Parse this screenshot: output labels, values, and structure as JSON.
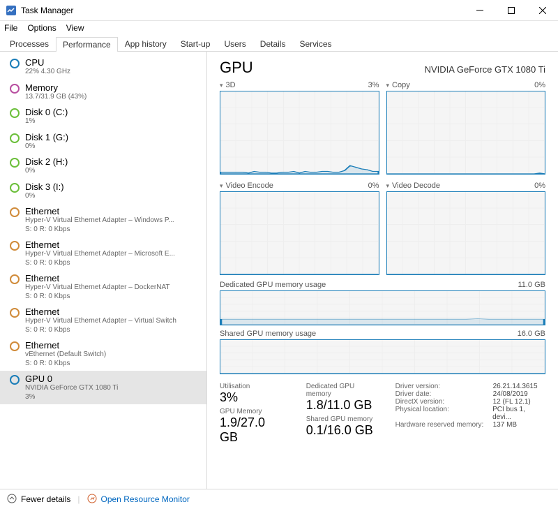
{
  "window": {
    "title": "Task Manager"
  },
  "menu": {
    "file": "File",
    "options": "Options",
    "view": "View"
  },
  "tabs": {
    "processes": "Processes",
    "performance": "Performance",
    "app_history": "App history",
    "start_up": "Start-up",
    "users": "Users",
    "details": "Details",
    "services": "Services"
  },
  "sidebar": {
    "items": [
      {
        "name": "CPU",
        "sub": "22% 4.30 GHz",
        "color": "#1a7db8"
      },
      {
        "name": "Memory",
        "sub": "13.7/31.9 GB (43%)",
        "color": "#b84fa0"
      },
      {
        "name": "Disk 0 (C:)",
        "sub": "1%",
        "color": "#6bbf3a"
      },
      {
        "name": "Disk 1 (G:)",
        "sub": "0%",
        "color": "#6bbf3a"
      },
      {
        "name": "Disk 2 (H:)",
        "sub": "0%",
        "color": "#6bbf3a"
      },
      {
        "name": "Disk 3 (I:)",
        "sub": "0%",
        "color": "#6bbf3a"
      },
      {
        "name": "Ethernet",
        "sub": "Hyper-V Virtual Ethernet Adapter – Windows P...",
        "sub2": "S: 0 R: 0 Kbps",
        "color": "#d08b3a"
      },
      {
        "name": "Ethernet",
        "sub": "Hyper-V Virtual Ethernet Adapter – Microsoft E...",
        "sub2": "S: 0 R: 0 Kbps",
        "color": "#d08b3a"
      },
      {
        "name": "Ethernet",
        "sub": "Hyper-V Virtual Ethernet Adapter – DockerNAT",
        "sub2": "S: 0 R: 0 Kbps",
        "color": "#d08b3a"
      },
      {
        "name": "Ethernet",
        "sub": "Hyper-V Virtual Ethernet Adapter – Virtual Switch",
        "sub2": "S: 0 R: 0 Kbps",
        "color": "#d08b3a"
      },
      {
        "name": "Ethernet",
        "sub": "vEthernet (Default Switch)",
        "sub2": "S: 0 R: 0 Kbps",
        "color": "#d08b3a"
      },
      {
        "name": "GPU 0",
        "sub": "NVIDIA GeForce GTX 1080 Ti",
        "sub2": "3%",
        "color": "#1a7db8"
      }
    ]
  },
  "main": {
    "title": "GPU",
    "device": "NVIDIA GeForce GTX 1080 Ti",
    "charts": [
      {
        "label": "3D",
        "value": "3%"
      },
      {
        "label": "Copy",
        "value": "0%"
      },
      {
        "label": "Video Encode",
        "value": "0%"
      },
      {
        "label": "Video Decode",
        "value": "0%"
      }
    ],
    "mem1": {
      "label": "Dedicated GPU memory usage",
      "max": "11.0 GB"
    },
    "mem2": {
      "label": "Shared GPU memory usage",
      "max": "16.0 GB"
    },
    "stats": {
      "util_label": "Utilisation",
      "util": "3%",
      "gmem_label": "GPU Memory",
      "gmem": "1.9/27.0 GB",
      "dmem_label": "Dedicated GPU memory",
      "dmem": "1.8/11.0 GB",
      "smem_label": "Shared GPU memory",
      "smem": "0.1/16.0 GB"
    },
    "details": {
      "driver_version_k": "Driver version:",
      "driver_version_v": "26.21.14.3615",
      "driver_date_k": "Driver date:",
      "driver_date_v": "24/08/2019",
      "directx_k": "DirectX version:",
      "directx_v": "12 (FL 12.1)",
      "location_k": "Physical location:",
      "location_v": "PCI bus 1, devi...",
      "reserved_k": "Hardware reserved memory:",
      "reserved_v": "137 MB"
    }
  },
  "footer": {
    "fewer": "Fewer details",
    "resmon": "Open Resource Monitor"
  },
  "chart_data": [
    {
      "type": "line",
      "title": "3D",
      "ylim": [
        0,
        100
      ],
      "values": [
        2,
        2,
        2,
        2,
        2,
        1,
        3,
        2,
        2,
        1,
        1,
        2,
        2,
        3,
        1,
        3,
        2,
        2,
        3,
        3,
        2,
        2,
        4,
        10,
        8,
        6,
        5,
        3,
        3
      ]
    },
    {
      "type": "line",
      "title": "Copy",
      "ylim": [
        0,
        100
      ],
      "values": [
        0,
        0,
        0,
        0,
        0,
        0,
        0,
        0,
        0,
        0,
        0,
        0,
        0,
        0,
        0,
        0,
        0,
        0,
        0,
        0,
        0,
        0,
        0,
        0,
        0,
        0,
        0,
        0,
        1,
        0
      ]
    },
    {
      "type": "line",
      "title": "Video Encode",
      "ylim": [
        0,
        100
      ],
      "values": [
        0,
        0,
        0,
        0,
        0,
        0,
        0,
        0,
        0,
        0,
        0,
        0,
        0,
        0,
        0,
        0,
        0,
        0,
        0,
        0,
        0,
        0,
        0,
        0,
        0,
        0,
        0,
        0,
        0,
        0
      ]
    },
    {
      "type": "line",
      "title": "Video Decode",
      "ylim": [
        0,
        100
      ],
      "values": [
        0,
        0,
        0,
        0,
        0,
        0,
        0,
        0,
        0,
        0,
        0,
        0,
        0,
        0,
        0,
        0,
        0,
        0,
        0,
        0,
        0,
        0,
        0,
        0,
        0,
        0,
        0,
        0,
        0,
        0
      ]
    },
    {
      "type": "line",
      "title": "Dedicated GPU memory usage",
      "ylim": [
        0,
        11
      ],
      "values": [
        1.8,
        1.8,
        1.8,
        1.8,
        1.8,
        1.8,
        1.8,
        1.8,
        1.8,
        1.8,
        1.8,
        1.8,
        1.8,
        1.8,
        1.8,
        1.8,
        1.8,
        1.8,
        1.8,
        1.8,
        1.8,
        1.8,
        1.8,
        1.9,
        1.8,
        1.8,
        1.8,
        1.8,
        1.8,
        1.8
      ]
    },
    {
      "type": "line",
      "title": "Shared GPU memory usage",
      "ylim": [
        0,
        16
      ],
      "values": [
        0.1,
        0.1,
        0.1,
        0.1,
        0.1,
        0.1,
        0.1,
        0.1,
        0.1,
        0.1,
        0.1,
        0.1,
        0.1,
        0.1,
        0.1,
        0.1,
        0.1,
        0.1,
        0.1,
        0.1,
        0.1,
        0.1,
        0.1,
        0.1,
        0.1,
        0.1,
        0.1,
        0.1,
        0.1,
        0.1
      ]
    }
  ]
}
